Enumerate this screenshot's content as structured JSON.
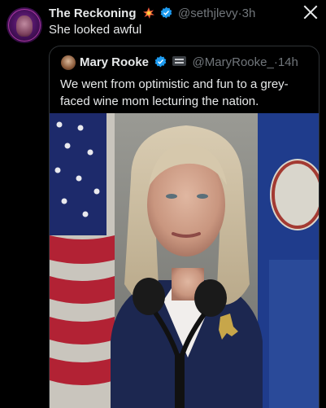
{
  "tweet": {
    "author_name": "The Reckoning",
    "author_handle": "@sethjlevy",
    "separator": "·",
    "time": "3h",
    "text": "She looked awful"
  },
  "quote": {
    "author_name": "Mary Rooke",
    "author_handle": "@MaryRooke_",
    "separator": "·",
    "time": "14h",
    "text": "We went from optimistic and fun to a grey-faced wine mom lecturing the nation."
  },
  "icons": {
    "close": "close-icon",
    "verified": "verified-badge-icon",
    "emoji": "collision-emoji-icon",
    "affiliate_badge": "affiliate-badge-icon"
  },
  "colors": {
    "background": "#000000",
    "text": "#e7e9ea",
    "muted": "#71767b",
    "verified": "#1d9bf0",
    "border": "#2f3336"
  }
}
